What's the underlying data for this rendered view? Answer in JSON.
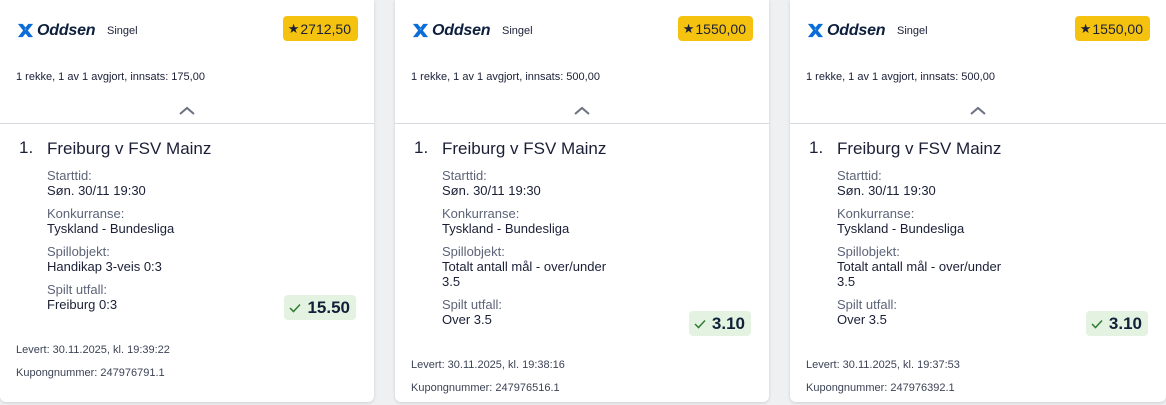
{
  "colors": {
    "badge": "#f5c30f",
    "odds_bg": "#e4f3e1",
    "brand_blue": "#0a6cd8",
    "text": "#1a1f36"
  },
  "coupons": [
    {
      "brand": "Oddsen",
      "type": "Singel",
      "total_odds": "2712,50",
      "summary": "1 rekke, 1 av 1 avgjort, innsats: 175,00",
      "item_number": "1.",
      "match": "Freiburg v FSV Mainz",
      "start_label": "Starttid:",
      "start_value": "Søn. 30/11 19:30",
      "comp_label": "Konkurranse:",
      "comp_value": "Tyskland - Bundesliga",
      "object_label": "Spillobjekt:",
      "object_line1": "Handikap 3-veis 0:3",
      "object_line2": "",
      "outcome_label": "Spilt utfall:",
      "outcome_value": "Freiburg 0:3",
      "odds": "15.50",
      "delivered": "Levert: 30.11.2025, kl. 19:39:22",
      "coupon_number": "Kupongnummer: 247976791.1"
    },
    {
      "brand": "Oddsen",
      "type": "Singel",
      "total_odds": "1550,00",
      "summary": "1 rekke, 1 av 1 avgjort, innsats: 500,00",
      "item_number": "1.",
      "match": "Freiburg v FSV Mainz",
      "start_label": "Starttid:",
      "start_value": "Søn. 30/11 19:30",
      "comp_label": "Konkurranse:",
      "comp_value": "Tyskland - Bundesliga",
      "object_label": "Spillobjekt:",
      "object_line1": "Totalt antall mål - over/under",
      "object_line2": "3.5",
      "outcome_label": "Spilt utfall:",
      "outcome_value": "Over 3.5",
      "odds": "3.10",
      "delivered": "Levert: 30.11.2025, kl. 19:38:16",
      "coupon_number": "Kupongnummer: 247976516.1"
    },
    {
      "brand": "Oddsen",
      "type": "Singel",
      "total_odds": "1550,00",
      "summary": "1 rekke, 1 av 1 avgjort, innsats: 500,00",
      "item_number": "1.",
      "match": "Freiburg v FSV Mainz",
      "start_label": "Starttid:",
      "start_value": "Søn. 30/11 19:30",
      "comp_label": "Konkurranse:",
      "comp_value": "Tyskland - Bundesliga",
      "object_label": "Spillobjekt:",
      "object_line1": "Totalt antall mål - over/under",
      "object_line2": "3.5",
      "outcome_label": "Spilt utfall:",
      "outcome_value": "Over 3.5",
      "odds": "3.10",
      "delivered": "Levert: 30.11.2025, kl. 19:37:53",
      "coupon_number": "Kupongnummer: 247976392.1"
    }
  ]
}
